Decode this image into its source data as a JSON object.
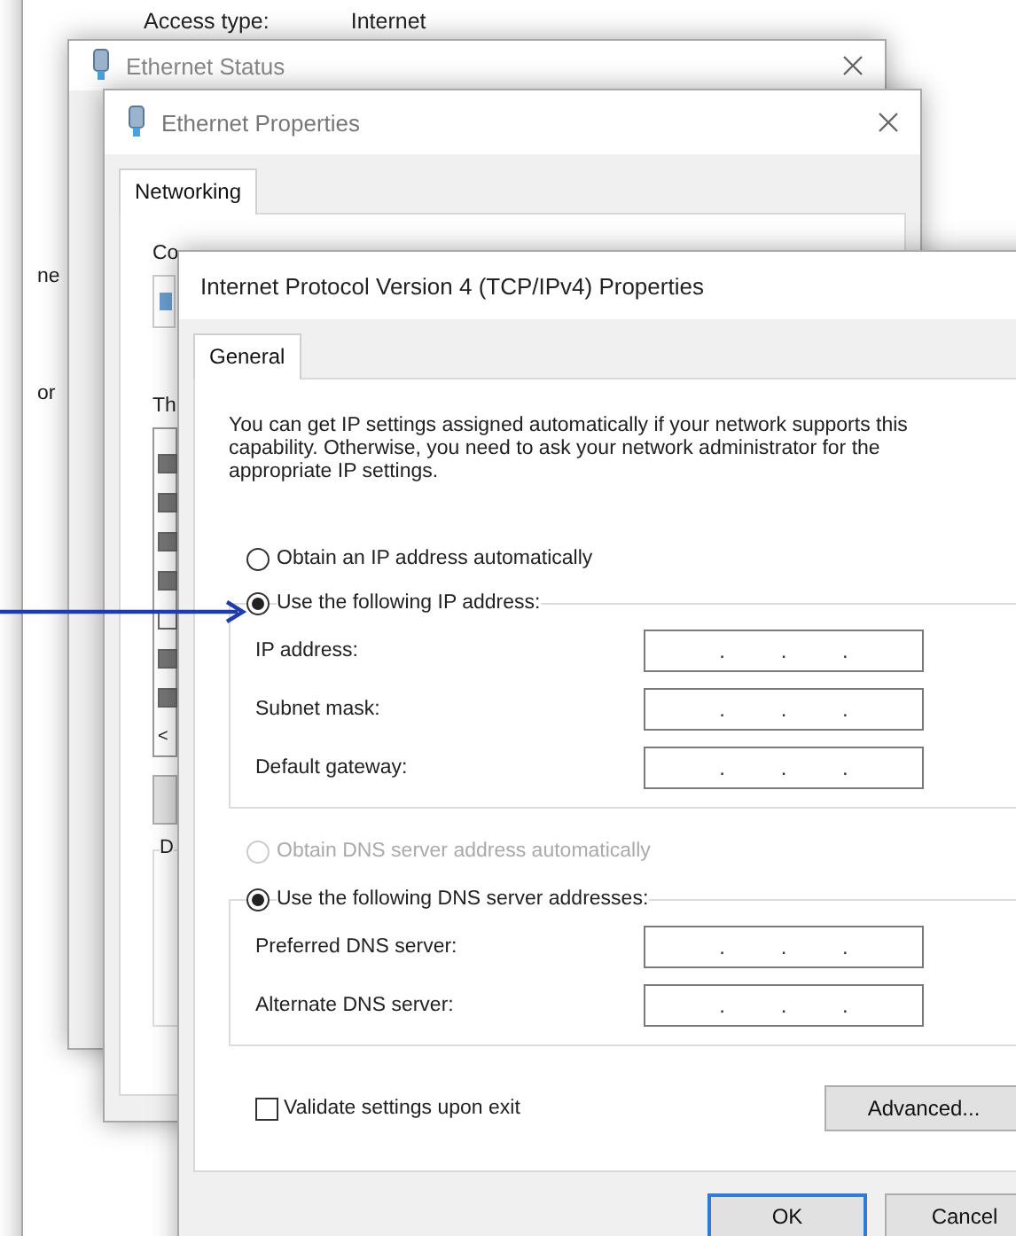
{
  "back_window": {
    "access_label": "Access type:",
    "access_value": "Internet",
    "side_texts": [
      "ne",
      "or"
    ]
  },
  "status_window": {
    "title": "Ethernet Status"
  },
  "properties_window": {
    "title": "Ethernet Properties",
    "tabs": [
      {
        "label": "Networking",
        "selected": true
      }
    ],
    "partial_texts": [
      "Co",
      "Th",
      "D"
    ],
    "components": [
      {
        "checked": true
      },
      {
        "checked": true
      },
      {
        "checked": true
      },
      {
        "checked": true
      },
      {
        "checked": false
      },
      {
        "checked": true
      },
      {
        "checked": true
      }
    ],
    "scroll_glyph": "<"
  },
  "ipv4_window": {
    "title": "Internet Protocol Version 4 (TCP/IPv4) Properties",
    "tabs": [
      {
        "label": "General",
        "selected": true
      }
    ],
    "description": "You can get IP settings assigned automatically if your network supports this capability. Otherwise, you need to ask your network administrator for the appropriate IP settings.",
    "ip_mode": [
      {
        "label": "Obtain an IP address automatically",
        "selected": false,
        "disabled": false
      },
      {
        "label": "Use the following IP address:",
        "selected": true,
        "disabled": false
      }
    ],
    "ip_fields": [
      {
        "label": "IP address:",
        "dots": [
          ".",
          ".",
          "."
        ]
      },
      {
        "label": "Subnet mask:",
        "dots": [
          ".",
          ".",
          "."
        ]
      },
      {
        "label": "Default gateway:",
        "dots": [
          ".",
          ".",
          "."
        ]
      }
    ],
    "dns_mode": [
      {
        "label": "Obtain DNS server address automatically",
        "selected": false,
        "disabled": true
      },
      {
        "label": "Use the following DNS server addresses:",
        "selected": true,
        "disabled": false
      }
    ],
    "dns_fields": [
      {
        "label": "Preferred DNS server:",
        "dots": [
          ".",
          ".",
          "."
        ]
      },
      {
        "label": "Alternate DNS server:",
        "dots": [
          ".",
          ".",
          "."
        ]
      }
    ],
    "validate": {
      "label": "Validate settings upon exit",
      "checked": false
    },
    "advanced_button": "Advanced...",
    "footer_buttons": [
      {
        "label": "OK",
        "default": true
      },
      {
        "label": "Cancel",
        "default": false
      }
    ]
  }
}
